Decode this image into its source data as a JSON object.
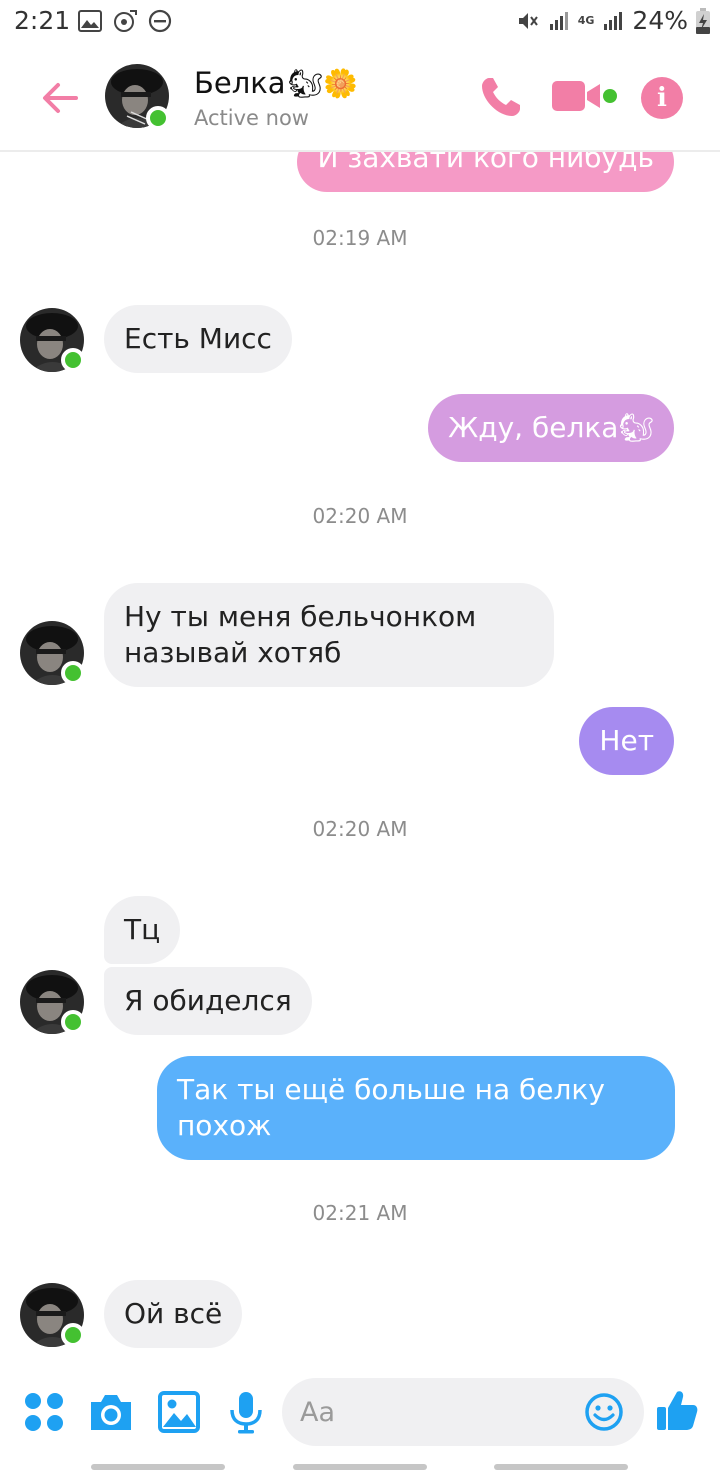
{
  "status_bar": {
    "time": "2:21",
    "battery": "24%",
    "network": "4G"
  },
  "header": {
    "contact_name": "Белка",
    "contact_emojis": "🐿🌼",
    "status": "Active now",
    "accent_color": "#f27ea6"
  },
  "messages": {
    "partial_top": "И захвати кого нибудь",
    "ts1": "02:19 AM",
    "in1": "Есть Мисс",
    "out1": "Жду, белка",
    "out1_emoji": "🐿",
    "ts2": "02:20 AM",
    "in2_line1": "Ну ты меня бельчонком",
    "in2_line2": "называй хотяб",
    "out2": "Нет",
    "ts3": "02:20 AM",
    "in3": "Тц",
    "in4": "Я обиделся",
    "out3_line1": "Так ты ещё больше на белку",
    "out3_line2": "похож",
    "ts4": "02:21 AM",
    "in5": "Ой всё"
  },
  "composer": {
    "placeholder": "Aa",
    "icon_color": "#1ea1f2"
  },
  "icons": {
    "back": "arrow-left-icon",
    "call": "phone-icon",
    "video": "video-camera-icon",
    "info": "info-icon",
    "more": "apps-grid-icon",
    "camera": "camera-icon",
    "gallery": "image-icon",
    "mic": "microphone-icon",
    "emoji": "smiley-icon",
    "like": "thumbs-up-icon"
  }
}
